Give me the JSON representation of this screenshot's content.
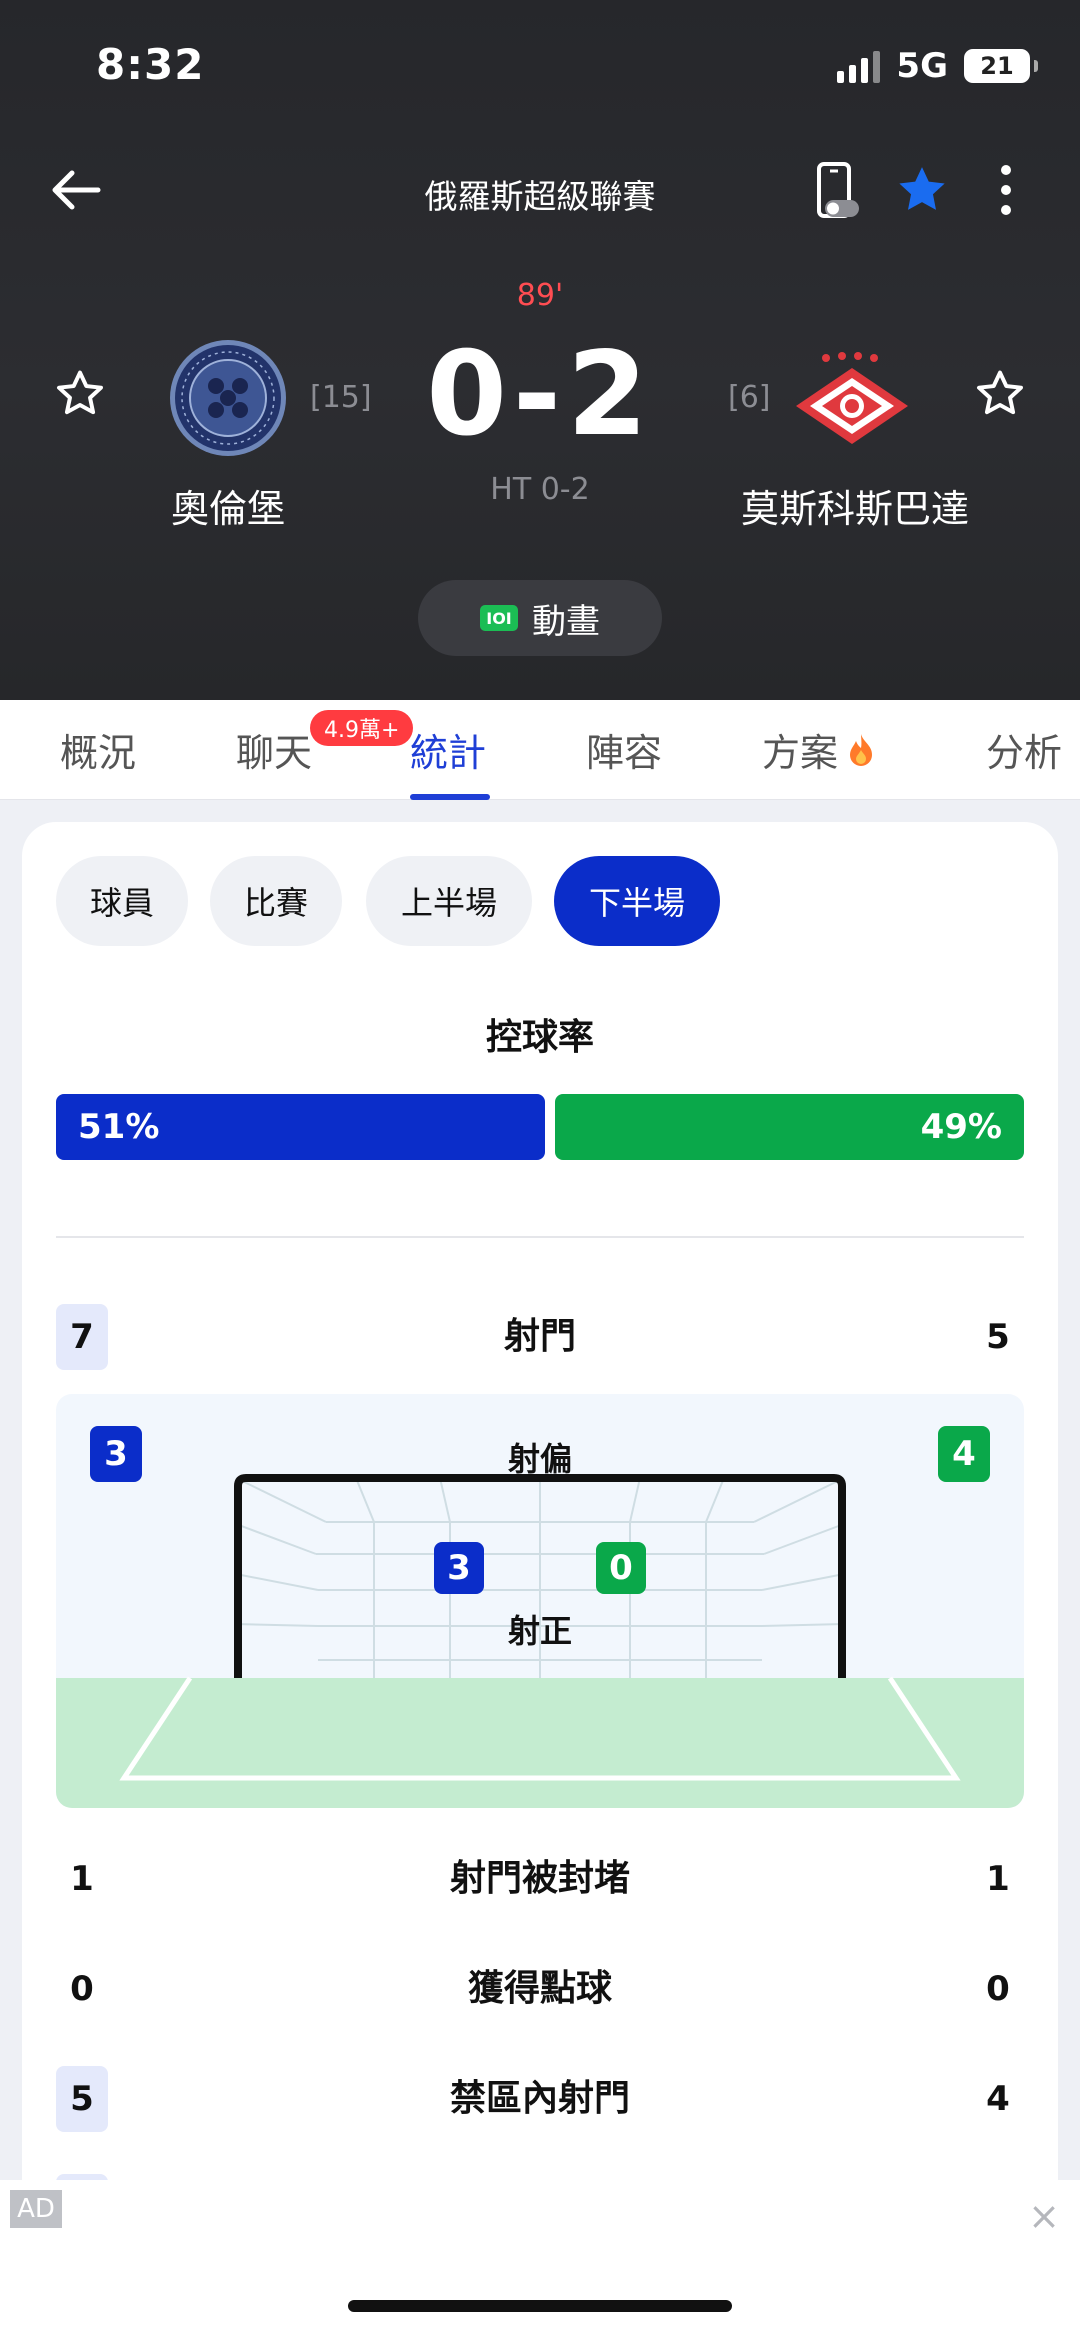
{
  "status": {
    "time": "8:32",
    "network": "5G",
    "battery": "21"
  },
  "header": {
    "league": "俄羅斯超級聯賽"
  },
  "match": {
    "minute": "89'",
    "score": "0-2",
    "halftime": "HT 0-2",
    "home": {
      "name": "奧倫堡",
      "rank": "[15]"
    },
    "away": {
      "name": "莫斯科斯巴達",
      "rank": "[6]"
    },
    "animation_label": "動畫",
    "animation_icon": "IOI"
  },
  "tabs": [
    {
      "label": "概況"
    },
    {
      "label": "聊天",
      "badge": "4.9萬+"
    },
    {
      "label": "統計"
    },
    {
      "label": "陣容"
    },
    {
      "label": "方案"
    },
    {
      "label": "分析"
    }
  ],
  "filters": [
    {
      "label": "球員"
    },
    {
      "label": "比賽"
    },
    {
      "label": "上半場"
    },
    {
      "label": "下半場"
    }
  ],
  "possession": {
    "title": "控球率",
    "home": "51%",
    "away": "49%",
    "home_fraction": 0.51,
    "away_fraction": 0.49
  },
  "shots": {
    "label": "射門",
    "home": "7",
    "away": "5"
  },
  "shots_diagram": {
    "off_target": {
      "label": "射偏",
      "home": "3",
      "away": "4"
    },
    "on_target": {
      "label": "射正",
      "home": "3",
      "away": "0"
    }
  },
  "stats": [
    {
      "label": "射門被封堵",
      "home": "1",
      "away": "1"
    },
    {
      "label": "獲得點球",
      "home": "0",
      "away": "0"
    },
    {
      "label": "禁區內射門",
      "home": "5",
      "away": "4"
    }
  ],
  "ad": {
    "tag": "AD",
    "close": "×"
  },
  "colors": {
    "home": "#0b2dc9",
    "away": "#0aa84a",
    "accent": "#1f3fd6",
    "live": "#ff4d52"
  }
}
